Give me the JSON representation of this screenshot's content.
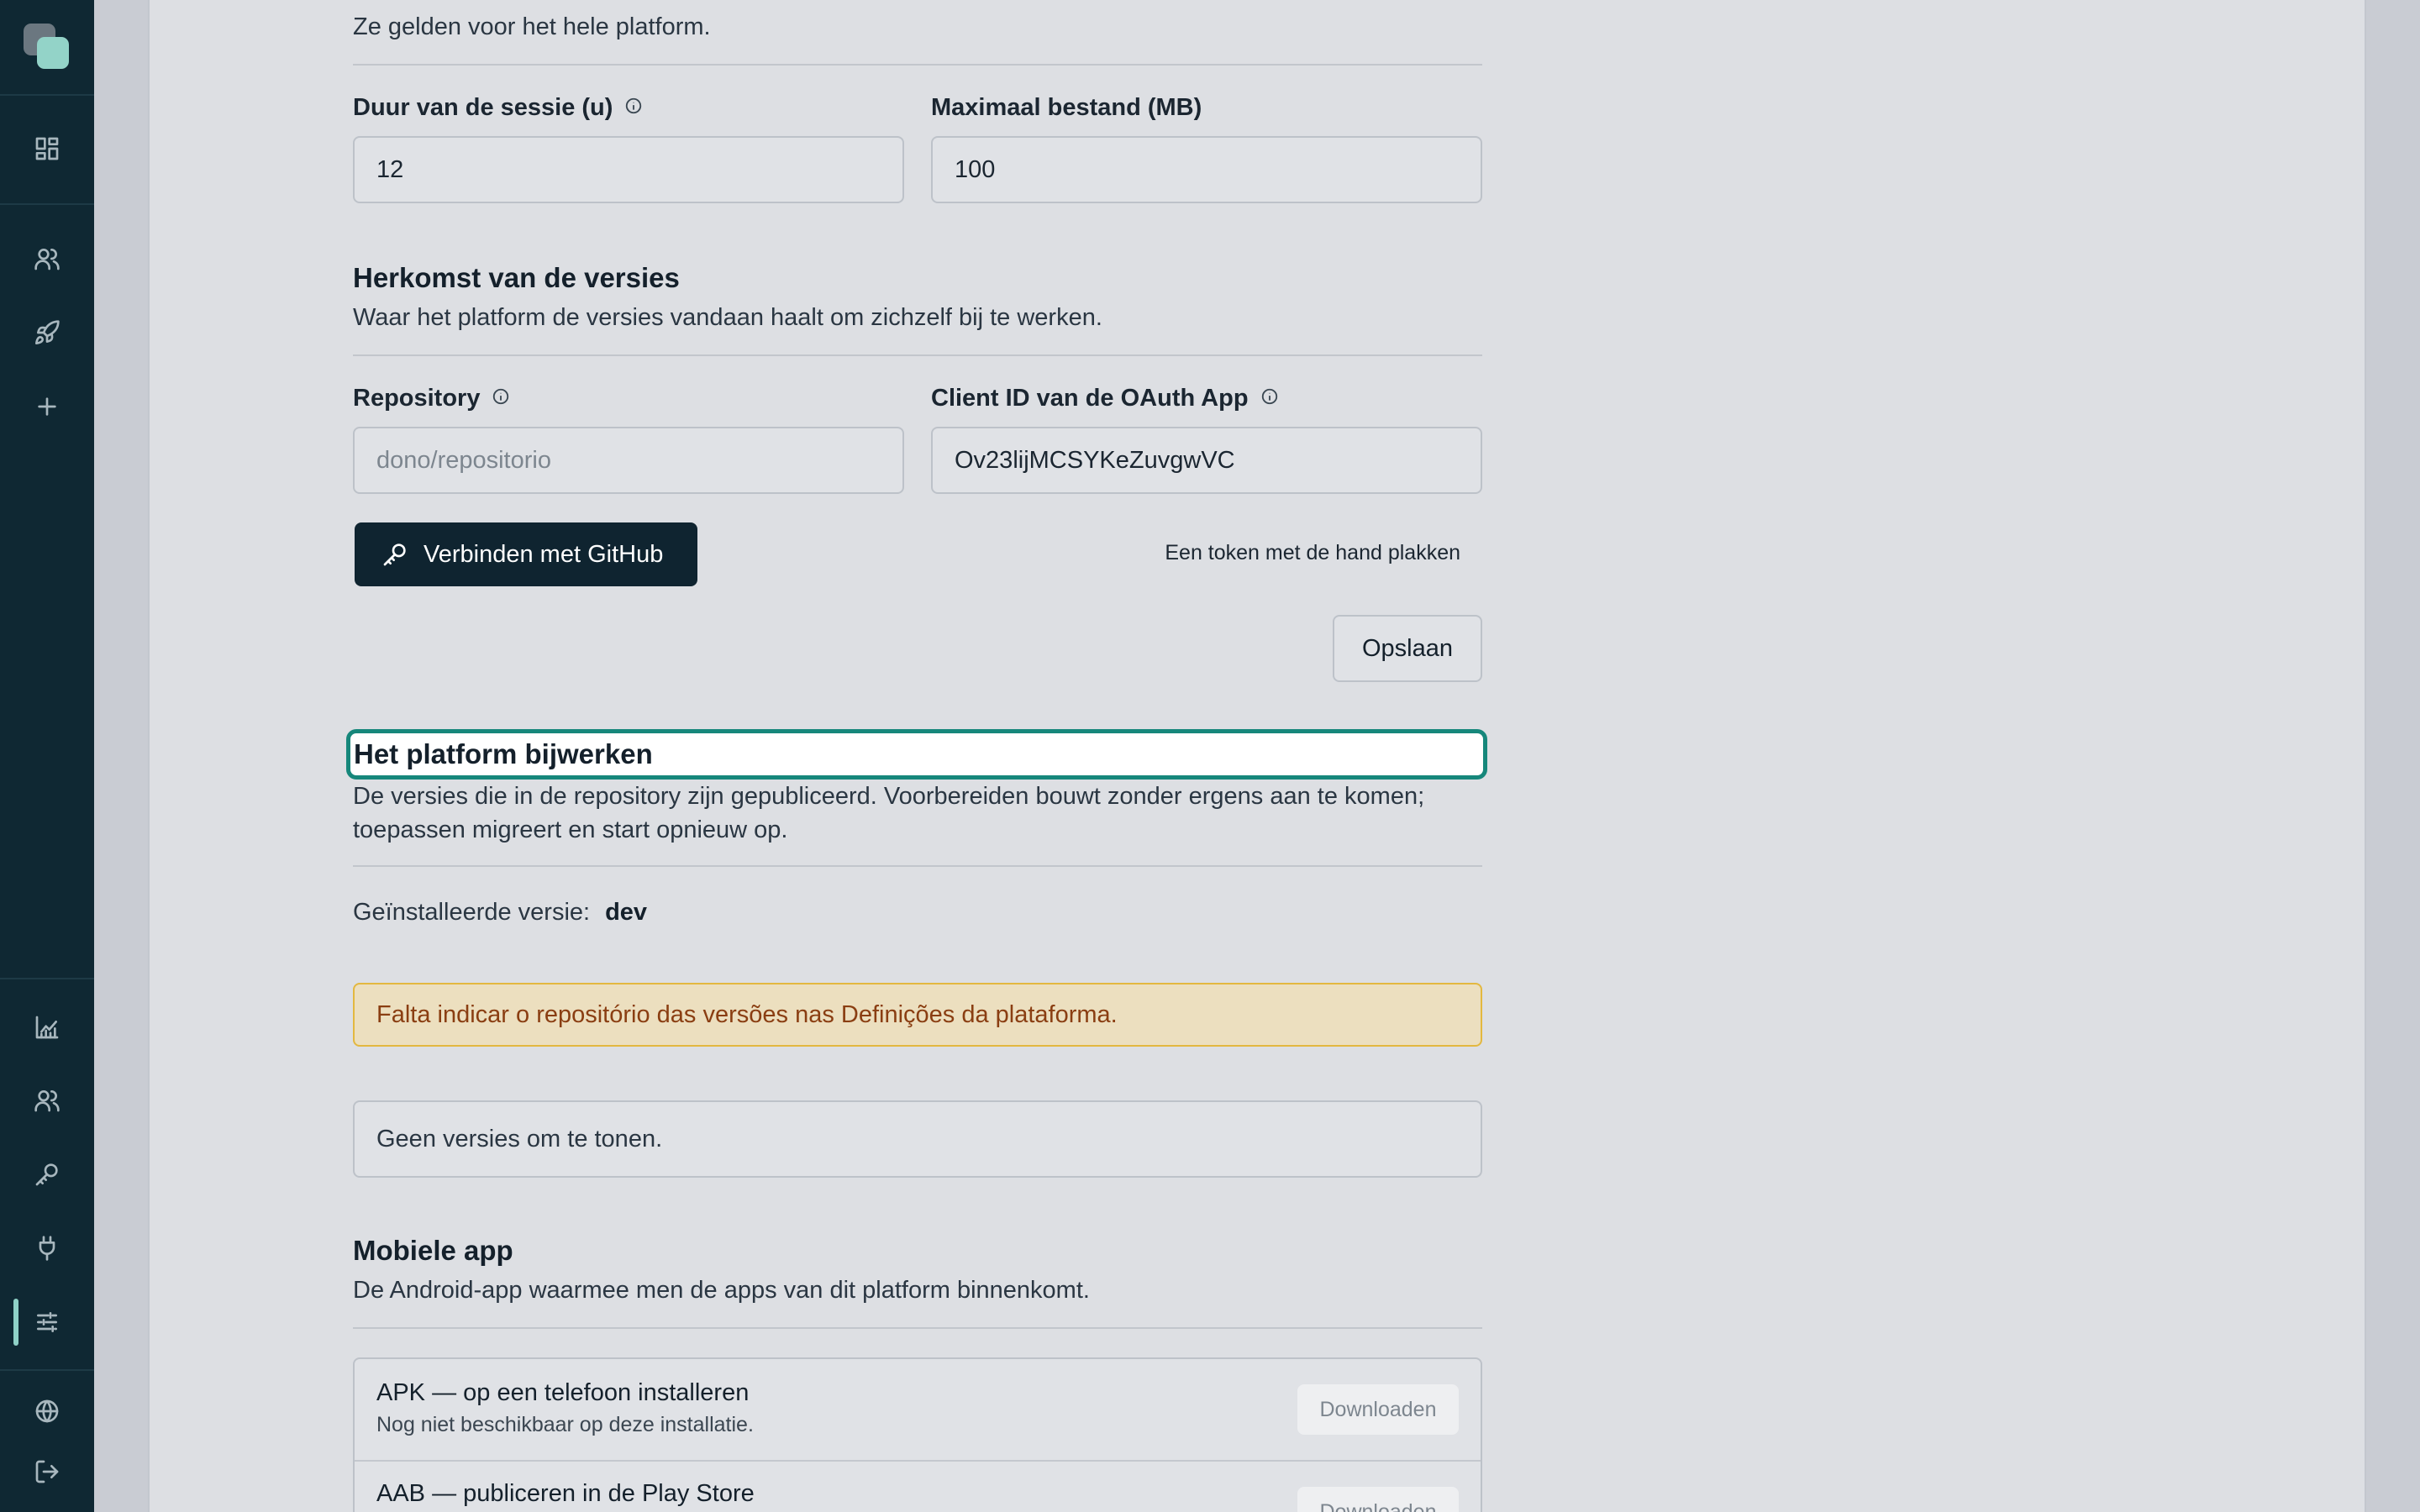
{
  "sidebar": {
    "top_icons": [
      "dashboard-icon",
      "users-icon",
      "rocket-icon",
      "plus-icon"
    ],
    "bottom_icons": [
      "chart-icon",
      "team-icon",
      "key-icon",
      "plug-icon",
      "sliders-icon"
    ],
    "footer_icons": [
      "globe-icon",
      "logout-icon"
    ],
    "active_item": "sliders-icon"
  },
  "general": {
    "description": "Ze gelden voor het hele platform.",
    "session_label": "Duur van de sessie (u)",
    "session_value": "12",
    "max_file_label": "Maximaal bestand (MB)",
    "max_file_value": "100"
  },
  "origin": {
    "title": "Herkomst van de versies",
    "description": "Waar het platform de versies vandaan haalt om zichzelf bij te werken.",
    "repository_label": "Repository",
    "repository_placeholder": "dono/repositorio",
    "client_id_label": "Client ID van de OAuth App",
    "client_id_value": "Ov23lijMCSYKeZuvgwVC",
    "connect_button": "Verbinden met GitHub",
    "manual_token_link": "Een token met de hand plakken",
    "save_button": "Opslaan"
  },
  "update": {
    "title": "Het platform bijwerken",
    "description_line1": "De versies die in de repository zijn gepubliceerd. Voorbereiden bouwt zonder ergens aan te komen;",
    "description_line2": "toepassen migreert en start opnieuw op.",
    "installed_label": "Geïnstalleerde versie:",
    "installed_value": "dev",
    "warning": "Falta indicar o repositório das versões nas Definições da plataforma.",
    "empty": "Geen versies om te tonen."
  },
  "mobile": {
    "title": "Mobiele app",
    "description": "De Android-app waarmee men de apps van dit platform binnenkomt.",
    "apk_title": "APK — op een telefoon installeren",
    "apk_sub": "Nog niet beschikbaar op deze installatie.",
    "apk_button": "Downloaden",
    "aab_title": "AAB — publiceren in de Play Store",
    "aab_button": "Downloaden"
  },
  "colors": {
    "sidebar": "#0f2833",
    "accent": "#16877b",
    "warning_border": "#e3b840",
    "warning_text": "#8a3e12"
  }
}
